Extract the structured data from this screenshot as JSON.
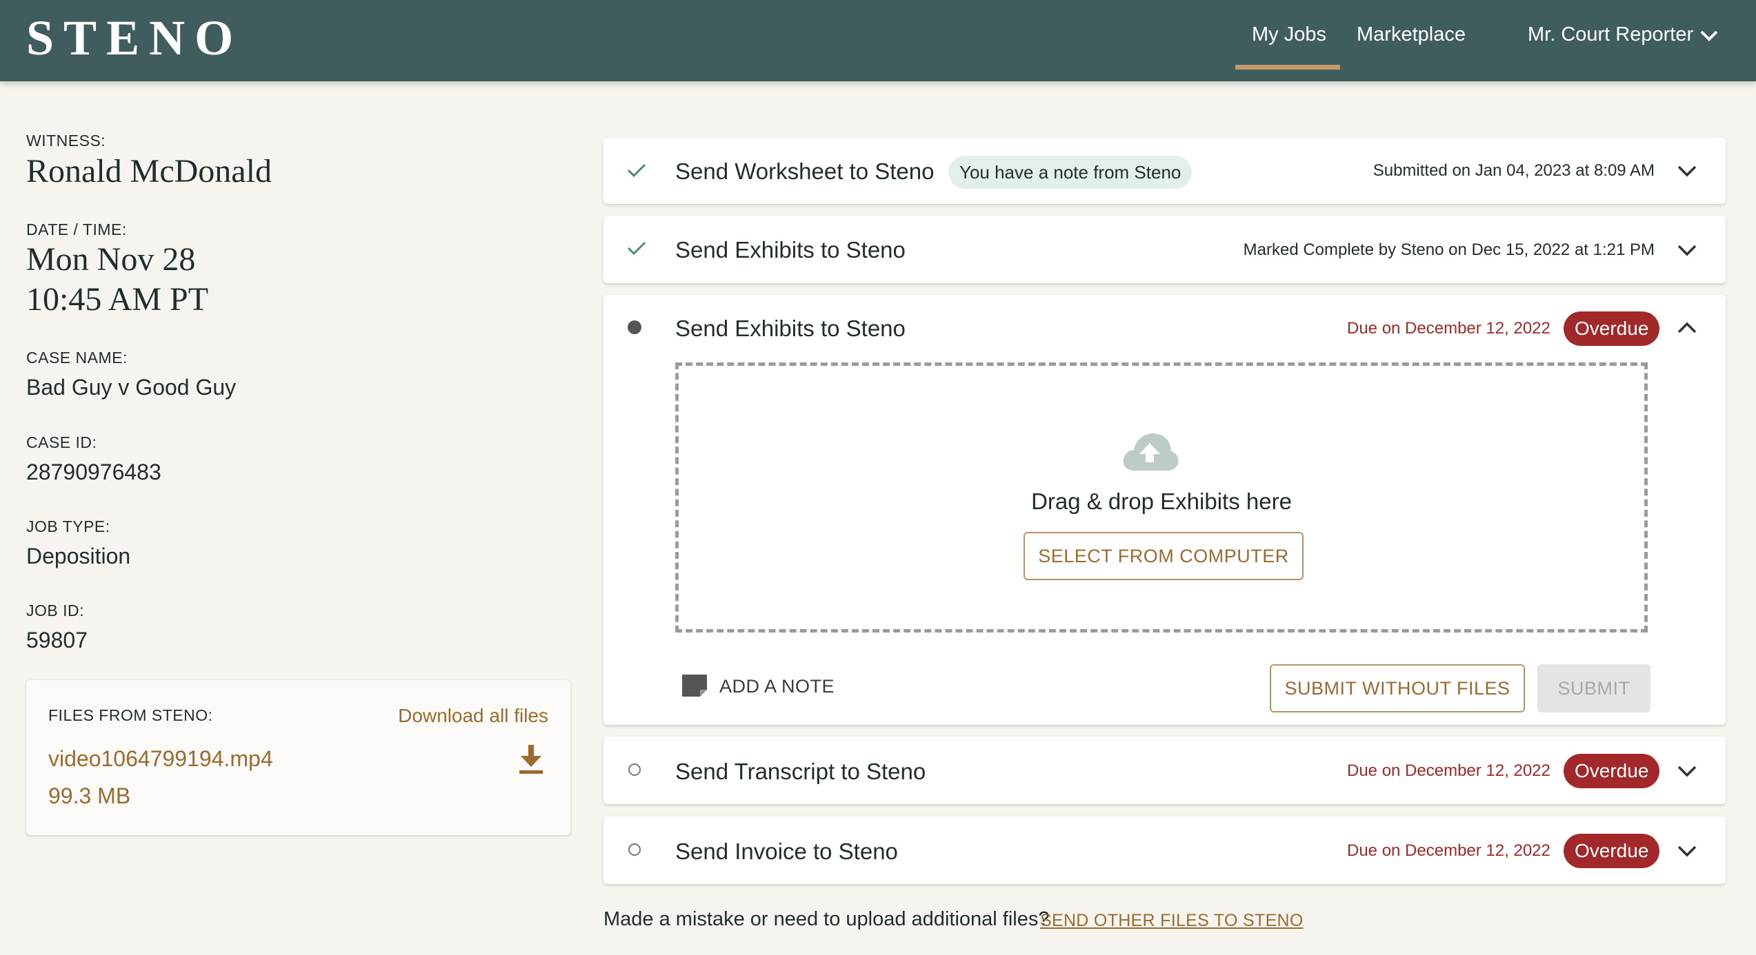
{
  "header": {
    "logo": "STENO",
    "nav": {
      "my_jobs": "My Jobs",
      "marketplace": "Marketplace",
      "user": "Mr. Court Reporter"
    }
  },
  "job": {
    "witness_label": "WITNESS:",
    "witness": "Ronald McDonald",
    "datetime_label": "DATE / TIME:",
    "date": "Mon Nov 28",
    "time": "10:45 AM PT",
    "case_name_label": "CASE NAME:",
    "case_name": "Bad Guy v Good Guy",
    "case_id_label": "CASE ID:",
    "case_id": "28790976483",
    "job_type_label": "JOB TYPE:",
    "job_type": "Deposition",
    "job_id_label": "JOB ID:",
    "job_id": "59807"
  },
  "files": {
    "label": "FILES FROM STENO:",
    "download_all": "Download all files",
    "items": [
      {
        "name": "video1064799194.mp4",
        "size": "99.3 MB"
      }
    ]
  },
  "tasks": [
    {
      "title": "Send Worksheet to Steno",
      "status": "complete",
      "note_chip": "You have a note from Steno",
      "meta": "Submitted on Jan 04, 2023 at 8:09 AM",
      "expanded": false
    },
    {
      "title": "Send Exhibits to Steno",
      "status": "complete",
      "meta": "Marked Complete by Steno on Dec 15, 2022 at 1:21 PM",
      "expanded": false
    },
    {
      "title": "Send Exhibits to Steno",
      "status": "active",
      "due": "Due on December 12, 2022",
      "badge": "Overdue",
      "expanded": true,
      "dropzone": {
        "text": "Drag & drop Exhibits here",
        "select_button": "SELECT FROM COMPUTER"
      },
      "add_note": "ADD A NOTE",
      "submit_without_files": "SUBMIT WITHOUT FILES",
      "submit": "SUBMIT"
    },
    {
      "title": "Send Transcript to Steno",
      "status": "pending",
      "due": "Due on December 12, 2022",
      "badge": "Overdue",
      "expanded": false
    },
    {
      "title": "Send Invoice to Steno",
      "status": "pending",
      "due": "Due on December 12, 2022",
      "badge": "Overdue",
      "expanded": false
    }
  ],
  "footer": {
    "question": "Made a mistake or need to upload additional files?",
    "link": "SEND OTHER FILES TO STENO"
  },
  "colors": {
    "header": "#3f5d5d",
    "accent": "#9a6b2f",
    "overdue": "#a2282a",
    "check": "#4e8a78"
  },
  "icons": [
    "check-icon",
    "bullet-icon",
    "empty-circle-icon",
    "chevron-down-icon",
    "chevron-up-icon",
    "cloud-upload-icon",
    "note-icon",
    "download-icon"
  ]
}
